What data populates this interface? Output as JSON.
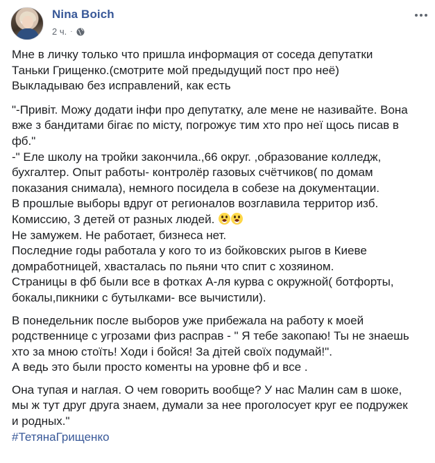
{
  "post": {
    "author": "Nina Boich",
    "time": "2 ч.",
    "separator": "·",
    "audience_icon": "globe-icon",
    "more_icon": "more-options-icon",
    "link_color": "#385898",
    "text_color": "#1c1e21",
    "meta_color": "#606770"
  },
  "body": {
    "p1_line1": "Мне в личку только что пришла информация от соседа депутатки",
    "p1_line2": "Таньки Грищенко.(смотрите мой предыдущий пост про неё)",
    "p1_line3": "Выкладываю без исправлений, как есть",
    "p2_line1": "\"-Привіт. Можу додати інфи про депутатку, але мене не називайте. Вона",
    "p2_line2": "вже з бандитами бігає по місту, погрожує тим хто про неї щось писав в",
    "p2_line3": "фб.\"",
    "p2_line4": "-\" Еле школу на тройки закончила.,66 округ. ,образование колледж,",
    "p2_line5": "бухгалтер. Опыт работы- контролёр газовых счётчиков( по домам",
    "p2_line6": "показания снимала), немного посидела в собезе на документации.",
    "p2_line7": "В прошлые выборы вдруг от регионалов возглавила территор изб.",
    "p2_line8": "Комиссию, 3 детей от разных людей.",
    "emoji_name": "face-screaming-emoji",
    "p2_line9": "Не замужем. Не работает, бизнеса нет.",
    "p2_line10": "Последние годы работала у кого то из бойковских рыгов в Киеве",
    "p2_line11": "домработницей, хвасталась по пьяни что спит с хозяином.",
    "p2_line12": "Страницы в фб были все в фотках А-ля курва с окружной( ботфорты,",
    "p2_line13": "бокалы,пикники с бутылками- все вычистили).",
    "p3_line1": "В понедельник после выборов уже прибежала на работу к моей",
    "p3_line2": "родственнице с угрозами физ расправ - \" Я тебе закопаю! Ты не знаешь",
    "p3_line3": "хто за мною стоїть! Ходи і бойся! За дітей своїх подумай!\".",
    "p3_line4": "А ведь это были просто коменты на уровне фб и все .",
    "p4_line1": "Она тупая и наглая. О чем говорить вообще? У нас Малин сам в шоке,",
    "p4_line2": "мы ж тут друг друга знаем, думали за нее проголосует круг ее подружек",
    "p4_line3": "и родных.\"",
    "hashtag": "#ТетянаГрищенко"
  }
}
